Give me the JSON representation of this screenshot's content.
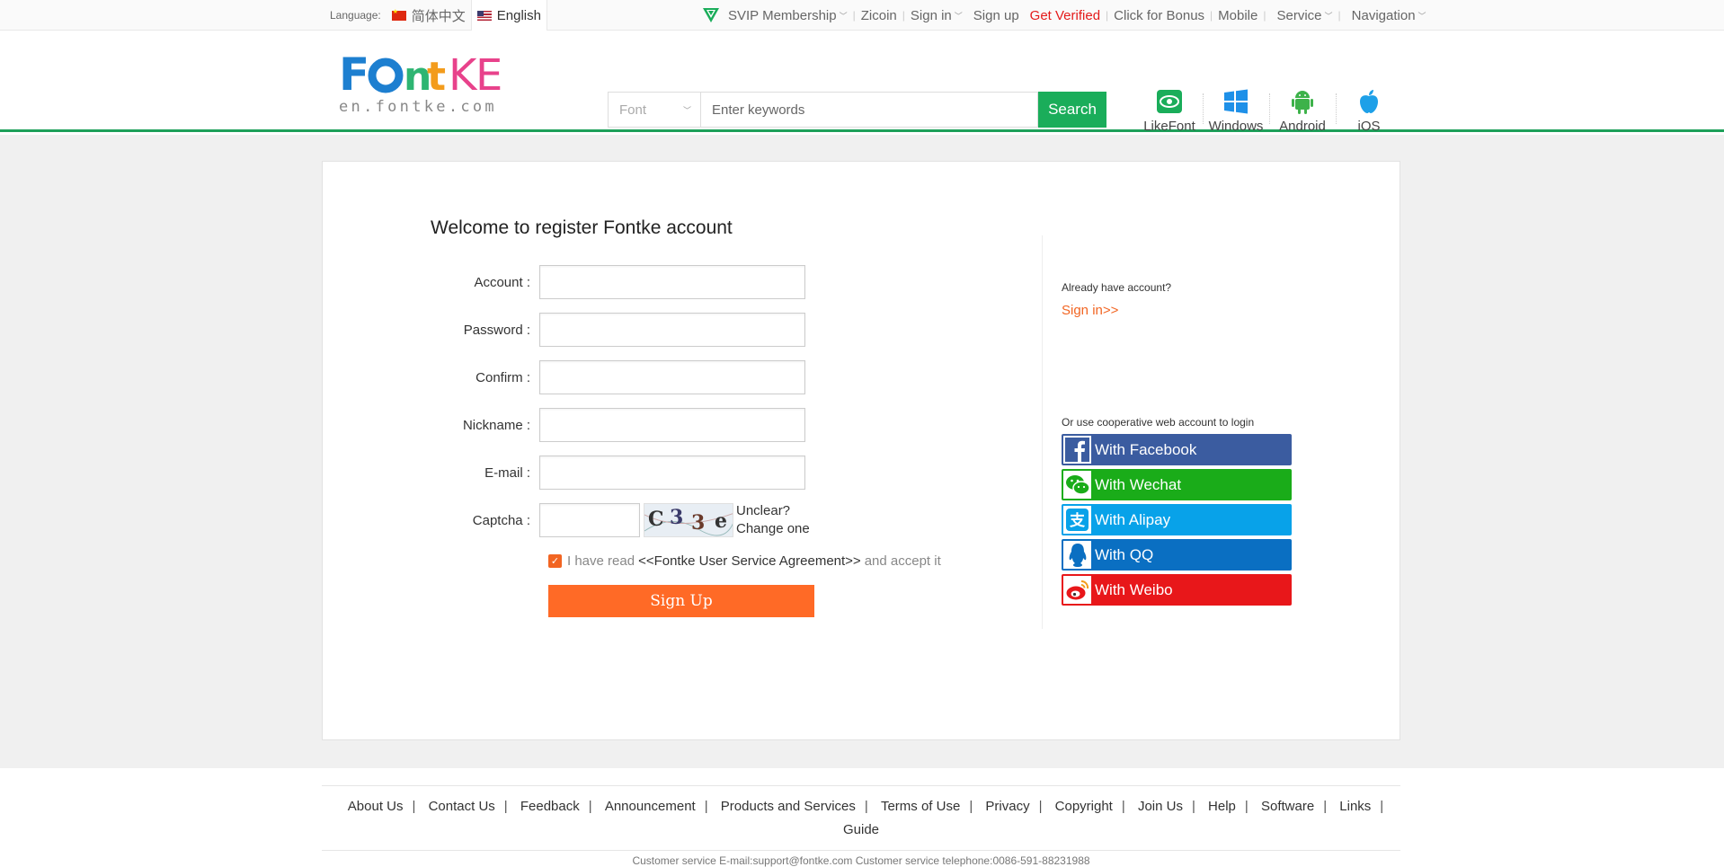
{
  "topbar": {
    "language_label": "Language:",
    "languages": [
      {
        "label": "简体中文",
        "flag": "china-flag-icon",
        "active": false
      },
      {
        "label": "English",
        "flag": "usa-flag-icon",
        "active": true
      }
    ],
    "nav": {
      "svip": "SVIP Membership",
      "zicoin": "Zicoin",
      "signin": "Sign in",
      "signup": "Sign up",
      "verified": "Get Verified",
      "bonus": "Click for Bonus",
      "mobile": "Mobile",
      "service": "Service",
      "navigation": "Navigation"
    }
  },
  "header": {
    "logo_word": "FONTKE",
    "logo_sub": "en.fontke.com",
    "search_select": "Font",
    "search_placeholder": "Enter keywords",
    "search_button": "Search",
    "apps": [
      "LikeFont",
      "Windows",
      "Android",
      "iOS"
    ]
  },
  "form": {
    "title": "Welcome to register Fontke account",
    "labels": {
      "account": "Account :",
      "password": "Password :",
      "confirm": "Confirm :",
      "nickname": "Nickname :",
      "email": "E-mail :",
      "captcha": "Captcha :"
    },
    "captcha_chars": [
      "C",
      "3",
      "3",
      "e"
    ],
    "captcha_help_1": "Unclear?",
    "captcha_help_2": "Change one",
    "agree_pre": "I have read",
    "agree_link": "<<Fontke User Service Agreement>>",
    "agree_post": "and accept it",
    "signup_button": "Sign Up"
  },
  "side": {
    "already": "Already have account?",
    "signin_link": "Sign in>>",
    "coop": "Or use cooperative web account to login",
    "buttons": {
      "facebook": "With Facebook",
      "wechat": "With Wechat",
      "alipay": "With Alipay",
      "qq": "With QQ",
      "weibo": "With Weibo"
    }
  },
  "colors": {
    "accent_green": "#1aad5a",
    "accent_orange": "#ff6a26",
    "red": "#e41b1b",
    "facebook": "#3b5ca0",
    "wechat": "#1aac19",
    "alipay": "#08a2e9",
    "qq": "#0a6fc2",
    "weibo": "#e8171a"
  },
  "footer": {
    "links": [
      "About Us",
      "Contact Us",
      "Feedback",
      "Announcement",
      "Products and Services",
      "Terms of Use",
      "Privacy",
      "Copyright",
      "Join Us",
      "Help",
      "Software",
      "Links",
      "Guide"
    ],
    "contact": "Customer service E-mail:support@fontke.com Customer service telephone:0086-591-88231988"
  }
}
